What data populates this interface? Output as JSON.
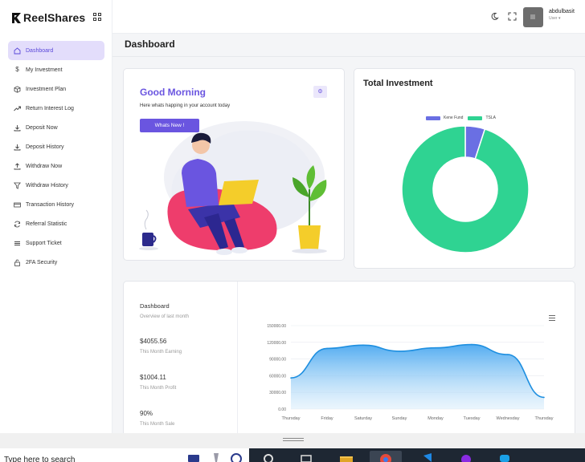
{
  "brand": {
    "name": "ReelShares"
  },
  "sidebar": {
    "items": [
      {
        "label": "Dashboard",
        "icon": "home-icon",
        "active": true
      },
      {
        "label": "My Investment",
        "icon": "dollar-icon"
      },
      {
        "label": "Investment Plan",
        "icon": "box-icon"
      },
      {
        "label": "Return Interest Log",
        "icon": "trend-icon"
      },
      {
        "label": "Deposit Now",
        "icon": "download-icon"
      },
      {
        "label": "Deposit History",
        "icon": "download-icon"
      },
      {
        "label": "Withdraw Now",
        "icon": "upload-icon"
      },
      {
        "label": "Withdraw History",
        "icon": "filter-icon"
      },
      {
        "label": "Transaction History",
        "icon": "card-icon"
      },
      {
        "label": "Referral Statistic",
        "icon": "refresh-icon"
      },
      {
        "label": "Support Ticket",
        "icon": "list-icon"
      },
      {
        "label": "2FA Security",
        "icon": "lock-icon"
      }
    ]
  },
  "topbar": {
    "user_name": "abdulbasit",
    "user_role": "User ▾"
  },
  "page": {
    "title": "Dashboard"
  },
  "welcome": {
    "greeting": "Good Morning",
    "subtitle": "Here whats happing in your account today",
    "button": "Whats New !"
  },
  "investment": {
    "title": "Total Investment",
    "legend": [
      "Kene Fund",
      "TSLA"
    ],
    "colors": [
      "#6a6fe3",
      "#2fd392"
    ],
    "chart_data": {
      "type": "pie",
      "labels": [
        "Kene Fund",
        "TSLA"
      ],
      "values": [
        5,
        95
      ]
    }
  },
  "stats": {
    "title": "Dashboard",
    "subtitle": "Overview of last month",
    "items": [
      {
        "value": "$4055.56",
        "label": "This Month Earning"
      },
      {
        "value": "$1004.11",
        "label": "This Month Profit"
      },
      {
        "value": "90%",
        "label": "This Month Sale"
      }
    ],
    "chart_data": {
      "type": "area",
      "categories": [
        "Thursday",
        "Friday",
        "Saturday",
        "Sunday",
        "Monday",
        "Tuesday",
        "Wednesday",
        "Thursday"
      ],
      "values": [
        56000,
        109000,
        115000,
        104000,
        110000,
        116000,
        98000,
        21000
      ],
      "y_ticks": [
        "150000.00",
        "120000.00",
        "90000.00",
        "60000.00",
        "30000.00",
        "0.00"
      ],
      "ylim": [
        0,
        150000
      ],
      "color": "#1e8fe0"
    }
  },
  "taskbar": {
    "search_text": "Type here to search"
  }
}
